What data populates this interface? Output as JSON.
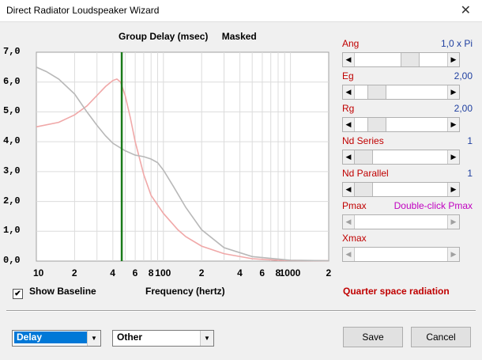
{
  "window": {
    "title": "Direct Radiator Loudspeaker Wizard"
  },
  "chart": {
    "title": "Group Delay (msec)",
    "mode_label": "Masked",
    "xlabel": "Frequency (hertz)"
  },
  "chart_data": {
    "type": "line",
    "title": "Group Delay (msec)",
    "xlabel": "Frequency (hertz)",
    "ylabel": "",
    "xscale": "log",
    "xlim": [
      10,
      2000
    ],
    "ylim": [
      0,
      7
    ],
    "yticks": [
      "0,0",
      "1,0",
      "2,0",
      "3,0",
      "4,0",
      "5,0",
      "6,0",
      "7,0"
    ],
    "xticks": [
      {
        "v": 10,
        "l": "10"
      },
      {
        "v": 20,
        "l": "2"
      },
      {
        "v": 40,
        "l": "4"
      },
      {
        "v": 60,
        "l": "6"
      },
      {
        "v": 80,
        "l": "8"
      },
      {
        "v": 100,
        "l": "100"
      },
      {
        "v": 200,
        "l": "2"
      },
      {
        "v": 400,
        "l": "4"
      },
      {
        "v": 600,
        "l": "6"
      },
      {
        "v": 800,
        "l": "8"
      },
      {
        "v": 1000,
        "l": "1000"
      },
      {
        "v": 2000,
        "l": "2"
      }
    ],
    "grid": true,
    "marker_x": 47,
    "colors": {
      "series1": "#f0a8a8",
      "series2": "#b8b8b8",
      "marker": "#1a7a1a"
    },
    "series": [
      {
        "x": [
          10,
          15,
          20,
          25,
          30,
          35,
          40,
          43,
          46,
          50,
          55,
          60,
          70,
          80,
          100,
          130,
          150,
          200,
          300,
          500,
          800,
          1000,
          2000
        ],
        "y": [
          4.5,
          4.65,
          4.9,
          5.2,
          5.55,
          5.85,
          6.05,
          6.1,
          6.0,
          5.55,
          4.8,
          4.0,
          2.9,
          2.2,
          1.6,
          1.05,
          0.82,
          0.5,
          0.25,
          0.08,
          0.03,
          0.02,
          0.01
        ]
      },
      {
        "x": [
          10,
          12,
          15,
          20,
          25,
          30,
          35,
          40,
          50,
          60,
          70,
          80,
          90,
          100,
          120,
          150,
          200,
          300,
          500,
          1000,
          2000
        ],
        "y": [
          6.5,
          6.35,
          6.1,
          5.6,
          5.0,
          4.55,
          4.2,
          3.95,
          3.7,
          3.55,
          3.5,
          3.42,
          3.3,
          3.05,
          2.5,
          1.8,
          1.05,
          0.45,
          0.15,
          0.03,
          0.01
        ]
      }
    ]
  },
  "controls": [
    {
      "label": "Ang",
      "value": "1,0 x Pi",
      "pos": 0.62,
      "disabled": false,
      "magenta": false
    },
    {
      "label": "Eg",
      "value": "2,00",
      "pos": 0.18,
      "disabled": false,
      "magenta": false
    },
    {
      "label": "Rg",
      "value": "2,00",
      "pos": 0.18,
      "disabled": false,
      "magenta": false
    },
    {
      "label": "Nd  Series",
      "value": "1",
      "pos": 0.0,
      "disabled": false,
      "magenta": false
    },
    {
      "label": "Nd  Parallel",
      "value": "1",
      "pos": 0.0,
      "disabled": false,
      "magenta": false
    },
    {
      "label": "Pmax",
      "value": "Double-click Pmax",
      "pos": 0.0,
      "disabled": true,
      "magenta": true
    },
    {
      "label": "Xmax",
      "value": "",
      "pos": 0.0,
      "disabled": true,
      "magenta": false
    }
  ],
  "baseline": {
    "label": "Show Baseline",
    "checked": true
  },
  "radiation_text": "Quarter space radiation",
  "dropdowns": {
    "primary": "Delay",
    "secondary": "Other"
  },
  "buttons": {
    "save": "Save",
    "cancel": "Cancel"
  }
}
